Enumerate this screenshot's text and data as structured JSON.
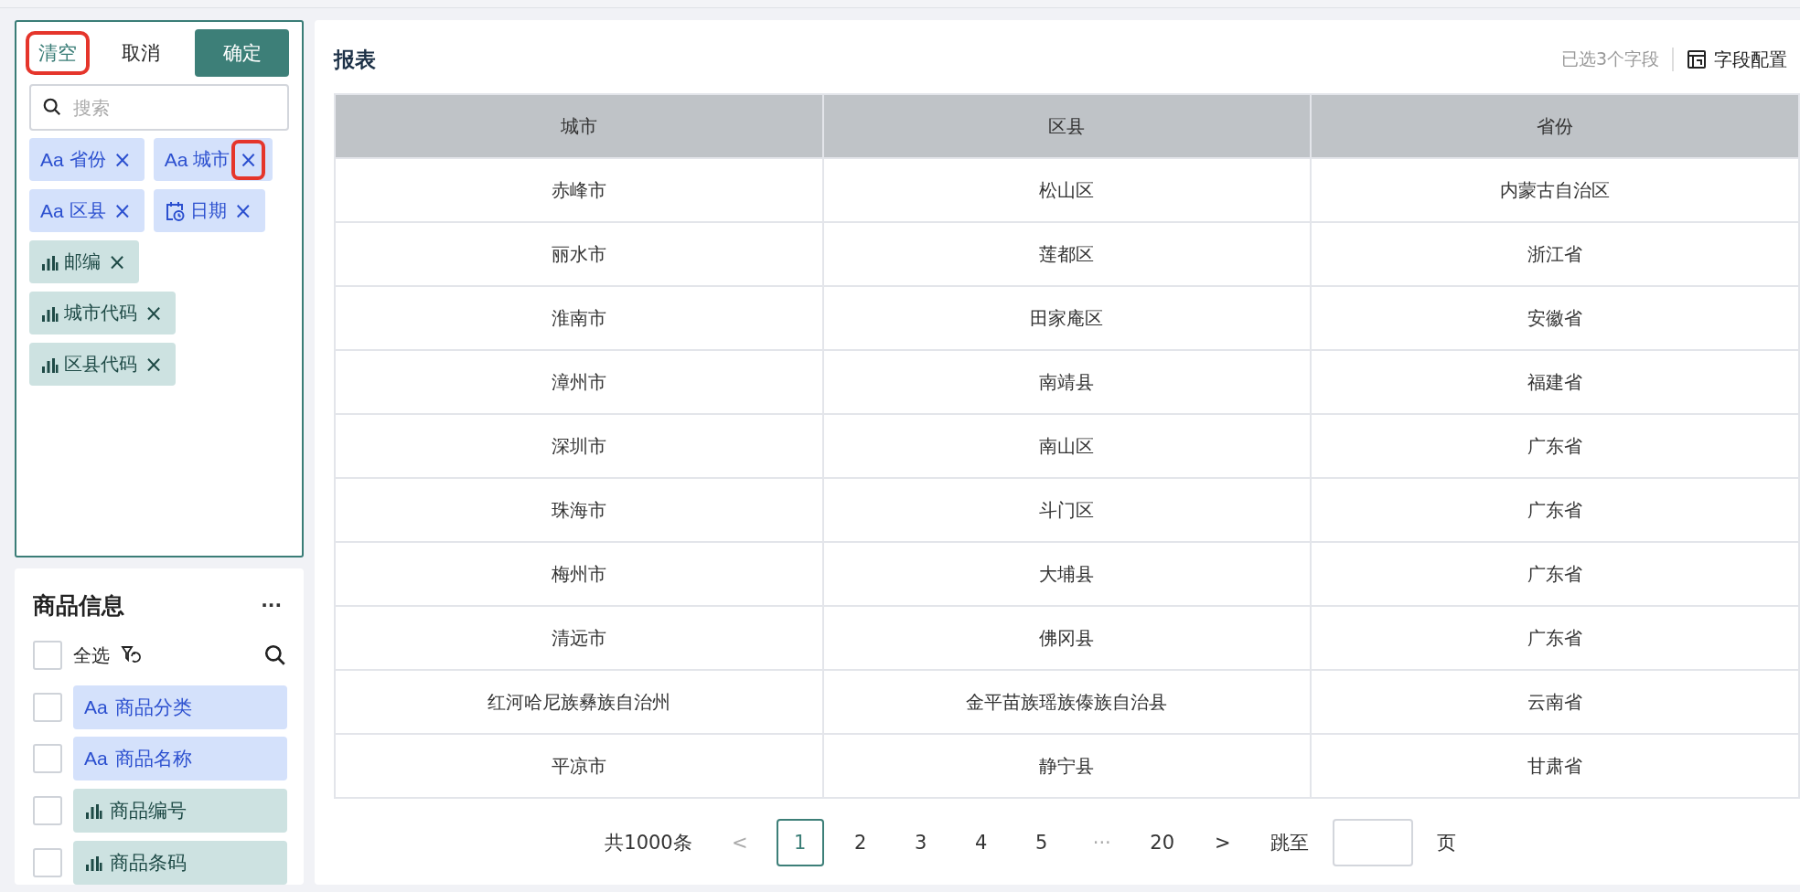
{
  "field_picker": {
    "actions": [
      {
        "label": "清空",
        "kind": "link",
        "highlighted": true
      },
      {
        "label": "取消",
        "kind": "plain",
        "highlighted": false
      },
      {
        "label": "确定",
        "kind": "primary",
        "highlighted": false
      }
    ],
    "search": {
      "placeholder": "搜索"
    },
    "chips": [
      {
        "kind": "text",
        "type_icon": "Aa",
        "label": "省份",
        "remove": "×",
        "remove_highlighted": false
      },
      {
        "kind": "text",
        "type_icon": "Aa",
        "label": "城市",
        "remove": "×",
        "remove_highlighted": true
      },
      {
        "kind": "text",
        "type_icon": "Aa",
        "label": "区县",
        "remove": "×",
        "remove_highlighted": false
      },
      {
        "kind": "date",
        "label": "日期",
        "remove": "×",
        "remove_highlighted": false
      },
      {
        "kind": "measure",
        "label": "邮编",
        "remove": "×",
        "remove_highlighted": false
      },
      {
        "kind": "measure",
        "label": "城市代码",
        "remove": "×",
        "remove_highlighted": false
      },
      {
        "kind": "measure",
        "label": "区县代码",
        "remove": "×",
        "remove_highlighted": false
      }
    ]
  },
  "dataset": {
    "title": "商品信息",
    "more": "···",
    "select_all": {
      "label": "全选",
      "checked": false
    },
    "fields": [
      {
        "kind": "text",
        "type_icon": "Aa",
        "label": "商品分类",
        "checked": false
      },
      {
        "kind": "text",
        "type_icon": "Aa",
        "label": "商品名称",
        "checked": false
      },
      {
        "kind": "measure",
        "label": "商品编号",
        "checked": false
      },
      {
        "kind": "measure",
        "label": "商品条码",
        "checked": false
      }
    ]
  },
  "report": {
    "title": "报表",
    "selected_count": "已选3个字段",
    "config_button": "字段配置",
    "table": {
      "columns": [
        "城市",
        "区县",
        "省份"
      ],
      "rows": [
        [
          "赤峰市",
          "松山区",
          "内蒙古自治区"
        ],
        [
          "丽水市",
          "莲都区",
          "浙江省"
        ],
        [
          "淮南市",
          "田家庵区",
          "安徽省"
        ],
        [
          "漳州市",
          "南靖县",
          "福建省"
        ],
        [
          "深圳市",
          "南山区",
          "广东省"
        ],
        [
          "珠海市",
          "斗门区",
          "广东省"
        ],
        [
          "梅州市",
          "大埔县",
          "广东省"
        ],
        [
          "清远市",
          "佛冈县",
          "广东省"
        ],
        [
          "红河哈尼族彝族自治州",
          "金平苗族瑶族傣族自治县",
          "云南省"
        ],
        [
          "平凉市",
          "静宁县",
          "甘肃省"
        ]
      ]
    },
    "pagination": {
      "total": "共1000条",
      "prev": "<",
      "pages": [
        {
          "label": "1",
          "selected": true
        },
        {
          "label": "2",
          "selected": false
        },
        {
          "label": "3",
          "selected": false
        },
        {
          "label": "4",
          "selected": false
        },
        {
          "label": "5",
          "selected": false
        }
      ],
      "ellipsis": "···",
      "last": {
        "label": "20",
        "selected": false
      },
      "next": ">",
      "jump_label": "跳至",
      "page_unit": "页"
    }
  }
}
